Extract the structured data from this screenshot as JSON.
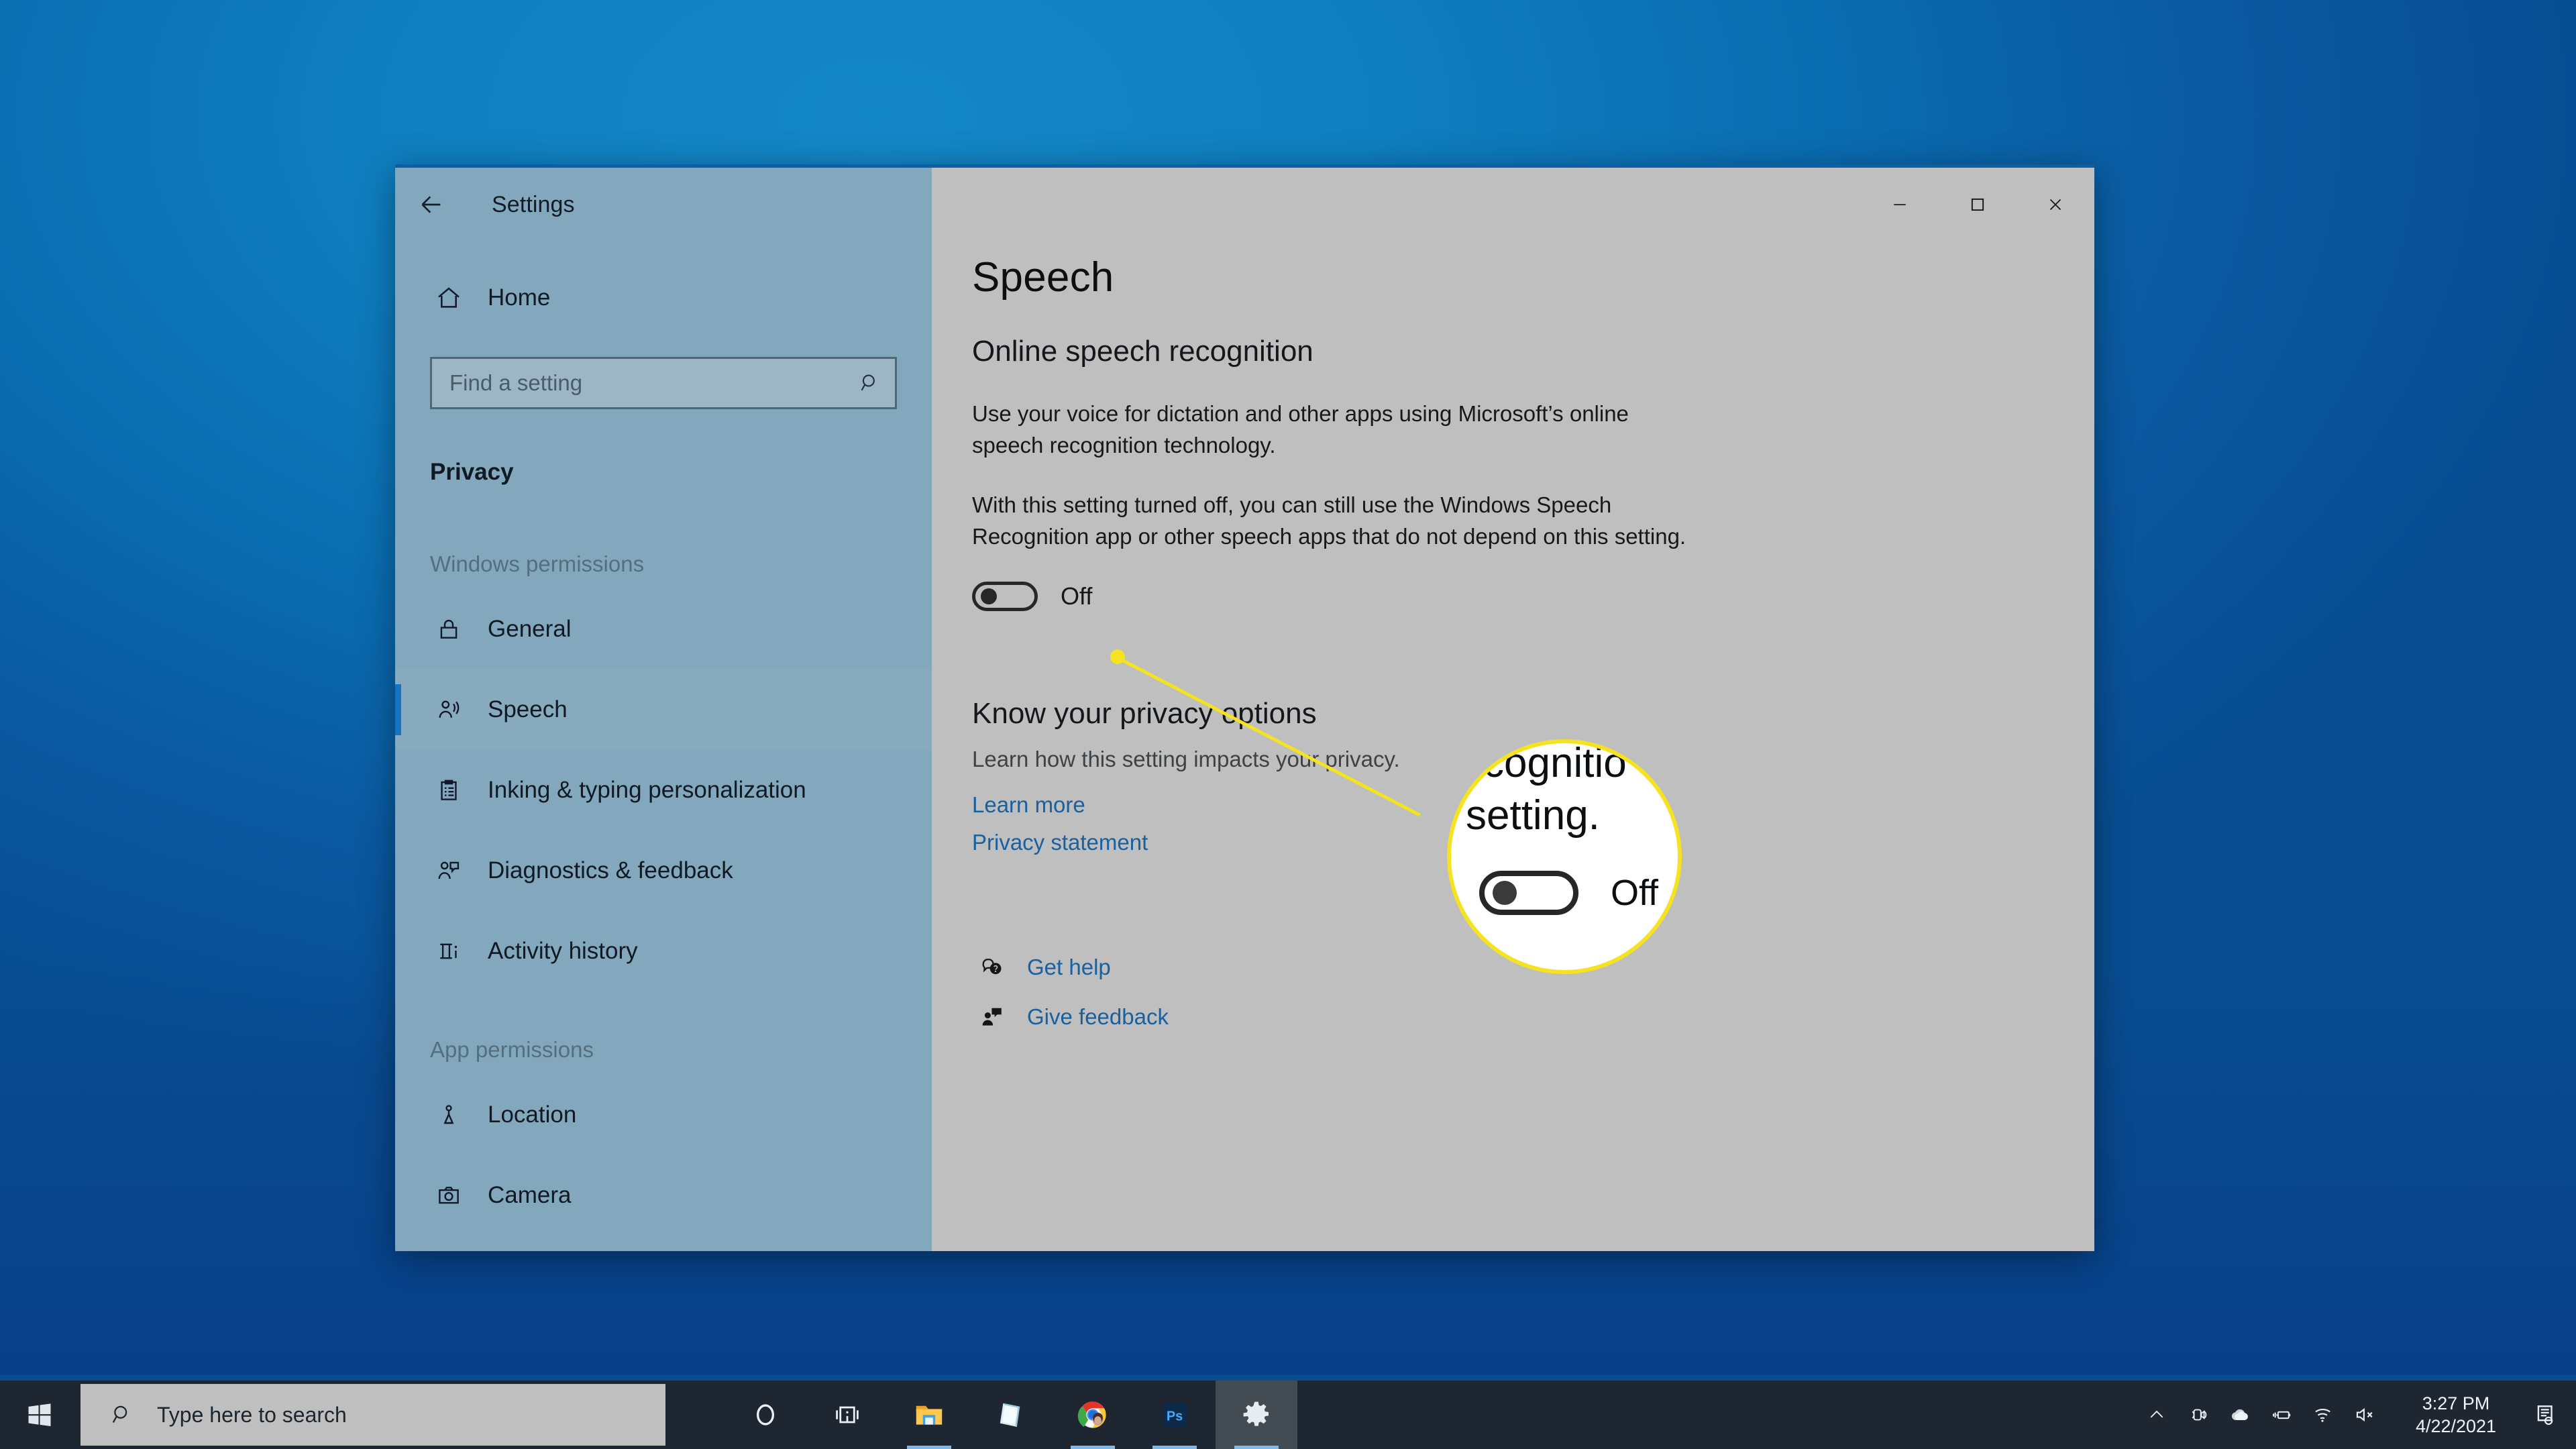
{
  "desktop": {
    "background_color": "#0d7ec2"
  },
  "window": {
    "title": "Settings",
    "back_icon": "back-arrow-icon",
    "controls": [
      {
        "name": "minimize",
        "glyph": "minimize-icon"
      },
      {
        "name": "maximize",
        "glyph": "maximize-icon"
      },
      {
        "name": "close",
        "glyph": "close-icon"
      }
    ]
  },
  "sidebar": {
    "home_label": "Home",
    "home_icon": "home-icon",
    "search": {
      "placeholder": "Find a setting",
      "value": "",
      "icon": "search-icon"
    },
    "category": "Privacy",
    "groups": [
      {
        "heading": "Windows permissions",
        "items": [
          {
            "label": "General",
            "icon": "lock-icon",
            "selected": false
          },
          {
            "label": "Speech",
            "icon": "speech-person-icon",
            "selected": true
          },
          {
            "label": "Inking & typing personalization",
            "icon": "clipboard-icon",
            "selected": false
          },
          {
            "label": "Diagnostics & feedback",
            "icon": "person-feedback-icon",
            "selected": false
          },
          {
            "label": "Activity history",
            "icon": "activity-history-icon",
            "selected": false
          }
        ]
      },
      {
        "heading": "App permissions",
        "items": [
          {
            "label": "Location",
            "icon": "location-icon",
            "selected": false
          },
          {
            "label": "Camera",
            "icon": "camera-icon",
            "selected": false
          }
        ]
      }
    ]
  },
  "main": {
    "page_title": "Speech",
    "section_title": "Online speech recognition",
    "paragraph_1": "Use your voice for dictation and other apps using Microsoft’s online speech recognition technology.",
    "paragraph_2": "With this setting turned off, you can still use the Windows Speech Recognition app or other speech apps that do not depend on this setting.",
    "toggle": {
      "state_label": "Off",
      "checked": false
    },
    "privacy_options": {
      "title": "Know your privacy options",
      "subtitle": "Learn how this setting impacts your privacy.",
      "links": [
        "Learn more",
        "Privacy statement"
      ]
    },
    "footer_links": [
      {
        "label": "Get help",
        "icon": "help-balloon-icon"
      },
      {
        "label": "Give feedback",
        "icon": "feedback-person-icon"
      }
    ]
  },
  "callout": {
    "accent_color": "#f5e321",
    "magnified_text_1": "cognitio",
    "magnified_text_2": "setting.",
    "magnified_toggle_state": "Off"
  },
  "taskbar": {
    "start_icon": "windows-logo-icon",
    "search": {
      "placeholder": "Type here to search",
      "icon": "search-icon"
    },
    "apps": [
      {
        "name": "cortana",
        "icon": "cortana-ring-icon",
        "running": false,
        "active": false
      },
      {
        "name": "task-view",
        "icon": "task-view-icon",
        "running": false,
        "active": false
      },
      {
        "name": "file-explorer",
        "icon": "folder-icon",
        "running": true,
        "active": false
      },
      {
        "name": "sticky-notes",
        "icon": "sticky-notes-icon",
        "running": false,
        "active": false
      },
      {
        "name": "google-chrome",
        "icon": "chrome-icon",
        "running": true,
        "active": false
      },
      {
        "name": "photoshop",
        "icon": "photoshop-icon",
        "running": true,
        "active": false
      },
      {
        "name": "settings",
        "icon": "gear-icon",
        "running": true,
        "active": true
      }
    ],
    "tray": [
      {
        "name": "show-hidden-icons",
        "icon": "chevron-up-icon"
      },
      {
        "name": "webcam-privacy",
        "icon": "camera-tray-icon"
      },
      {
        "name": "onedrive",
        "icon": "cloud-icon"
      },
      {
        "name": "battery-charging",
        "icon": "battery-plug-icon"
      },
      {
        "name": "network-wifi",
        "icon": "wifi-icon"
      },
      {
        "name": "volume-muted",
        "icon": "speaker-mute-icon"
      }
    ],
    "clock": {
      "time": "3:27 PM",
      "date": "4/22/2021"
    },
    "action_center_icon": "action-center-icon"
  }
}
